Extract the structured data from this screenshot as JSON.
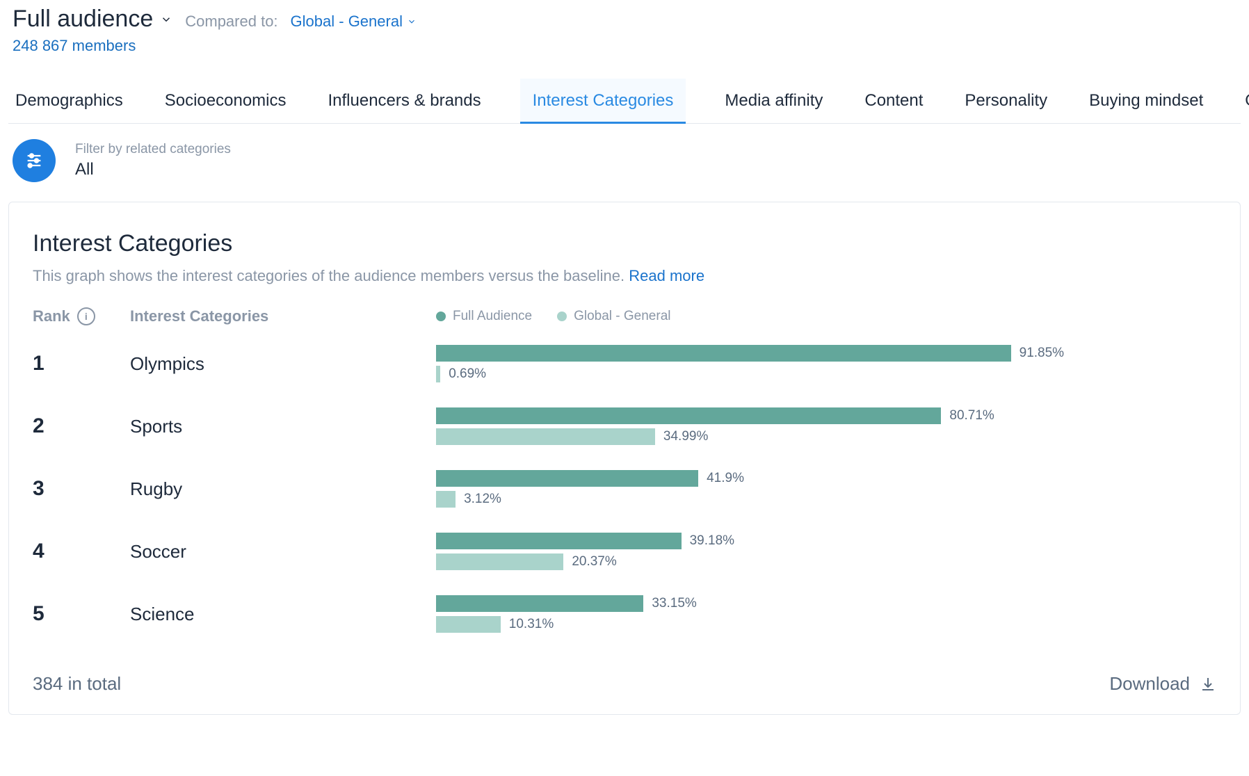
{
  "header": {
    "audience_title": "Full audience",
    "compared_label": "Compared to:",
    "compared_value": "Global - General",
    "members": "248 867 members"
  },
  "tabs": [
    {
      "label": "Demographics"
    },
    {
      "label": "Socioeconomics"
    },
    {
      "label": "Influencers & brands"
    },
    {
      "label": "Interest Categories",
      "active": true
    },
    {
      "label": "Media affinity"
    },
    {
      "label": "Content"
    },
    {
      "label": "Personality"
    },
    {
      "label": "Buying mindset"
    },
    {
      "label": "Online habits"
    }
  ],
  "filter": {
    "label": "Filter by related categories",
    "value": "All"
  },
  "panel": {
    "title": "Interest Categories",
    "desc": "This graph shows the interest categories of the audience members versus the baseline. ",
    "read_more": "Read more",
    "col_rank": "Rank",
    "col_cat": "Interest Categories",
    "legend_a": "Full Audience",
    "legend_b": "Global - General",
    "total": "384 in total",
    "download": "Download"
  },
  "colors": {
    "series_a": "#63a79b",
    "series_b": "#a9d3cb"
  },
  "chart_data": {
    "type": "bar",
    "orientation": "horizontal",
    "grouped": true,
    "xlim": [
      0,
      100
    ],
    "xlabel": "",
    "ylabel": "",
    "title": "Interest Categories",
    "categories": [
      "Olympics",
      "Sports",
      "Rugby",
      "Soccer",
      "Science"
    ],
    "series": [
      {
        "name": "Full Audience",
        "values": [
          91.85,
          80.71,
          41.9,
          39.18,
          33.15
        ]
      },
      {
        "name": "Global - General",
        "values": [
          0.69,
          34.99,
          3.12,
          20.37,
          10.31
        ]
      }
    ],
    "value_labels": [
      [
        "91.85%",
        "0.69%"
      ],
      [
        "80.71%",
        "34.99%"
      ],
      [
        "41.9%",
        "3.12%"
      ],
      [
        "39.18%",
        "20.37%"
      ],
      [
        "33.15%",
        "10.31%"
      ]
    ],
    "ranks": [
      "1",
      "2",
      "3",
      "4",
      "5"
    ]
  }
}
